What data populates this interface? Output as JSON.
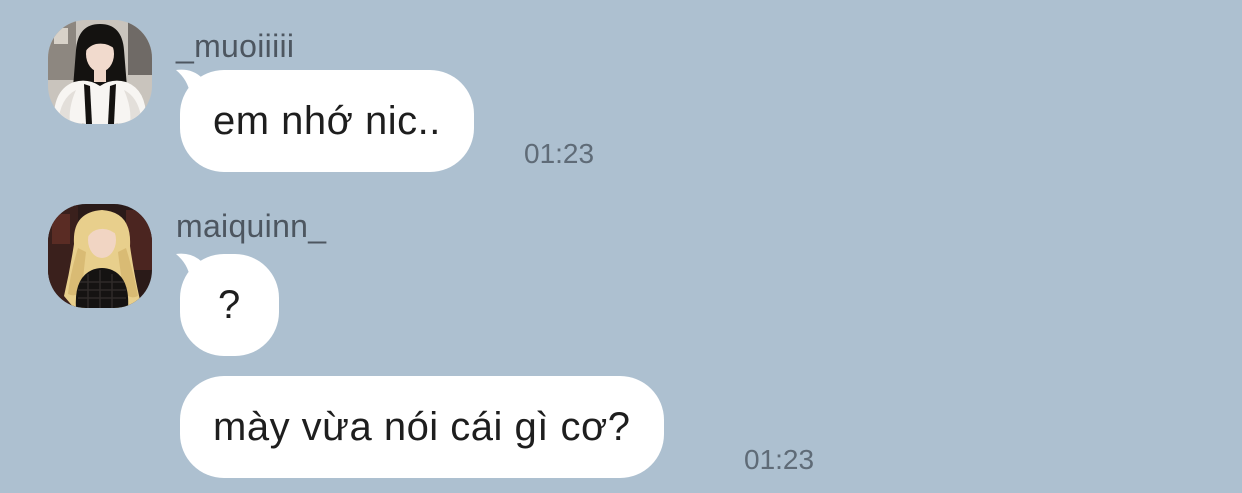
{
  "messages": [
    {
      "sender": "_muoiiiii",
      "avatar_icon": "profile-photo-dark-hair",
      "bubbles": [
        {
          "text": "em nhớ nic.."
        }
      ],
      "time": "01:23"
    },
    {
      "sender": "maiquinn_",
      "avatar_icon": "profile-photo-blonde-hair",
      "bubbles": [
        {
          "text": "?"
        },
        {
          "text": "mày vừa nói cái gì cơ?"
        }
      ],
      "time": "01:23"
    }
  ],
  "colors": {
    "background": "#adc0d0",
    "bubble": "#ffffff",
    "username_text": "#4d5660",
    "time_text": "#5f6b77"
  }
}
